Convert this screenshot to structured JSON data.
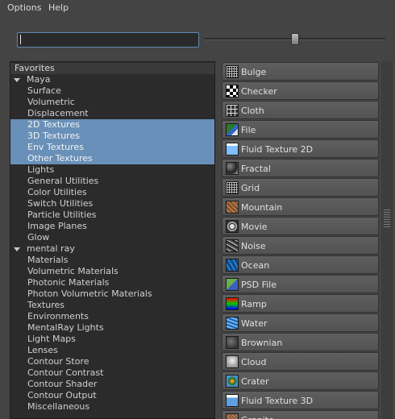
{
  "menu": {
    "items": [
      "Options",
      "Help"
    ]
  },
  "search": {
    "value": "",
    "placeholder": ""
  },
  "slider": {
    "value_fraction": 0.5
  },
  "tree": {
    "rows": [
      {
        "label": "Favorites",
        "kind": "top"
      },
      {
        "label": "Maya",
        "kind": "header"
      },
      {
        "label": "Surface",
        "kind": "item"
      },
      {
        "label": "Volumetric",
        "kind": "item"
      },
      {
        "label": "Displacement",
        "kind": "item"
      },
      {
        "label": "2D Textures",
        "kind": "item",
        "selected": true
      },
      {
        "label": "3D Textures",
        "kind": "item",
        "selected": true
      },
      {
        "label": "Env Textures",
        "kind": "item",
        "selected": true
      },
      {
        "label": "Other Textures",
        "kind": "item",
        "selected": true
      },
      {
        "label": "Lights",
        "kind": "item"
      },
      {
        "label": "General Utilities",
        "kind": "item"
      },
      {
        "label": "Color Utilities",
        "kind": "item"
      },
      {
        "label": "Switch Utilities",
        "kind": "item"
      },
      {
        "label": "Particle Utilities",
        "kind": "item"
      },
      {
        "label": "Image Planes",
        "kind": "item"
      },
      {
        "label": "Glow",
        "kind": "item"
      },
      {
        "label": "mental ray",
        "kind": "header"
      },
      {
        "label": "Materials",
        "kind": "item"
      },
      {
        "label": "Volumetric Materials",
        "kind": "item"
      },
      {
        "label": "Photonic Materials",
        "kind": "item"
      },
      {
        "label": "Photon Volumetric Materials",
        "kind": "item"
      },
      {
        "label": "Textures",
        "kind": "item"
      },
      {
        "label": "Environments",
        "kind": "item"
      },
      {
        "label": "MentalRay Lights",
        "kind": "item"
      },
      {
        "label": "Light Maps",
        "kind": "item"
      },
      {
        "label": "Lenses",
        "kind": "item"
      },
      {
        "label": "Contour Store",
        "kind": "item"
      },
      {
        "label": "Contour Contrast",
        "kind": "item"
      },
      {
        "label": "Contour Shader",
        "kind": "item"
      },
      {
        "label": "Contour Output",
        "kind": "item"
      },
      {
        "label": "Miscellaneous",
        "kind": "item"
      }
    ]
  },
  "nodes": [
    {
      "label": "Bulge",
      "icon": "bulge-icon",
      "swatch": "sw-grid"
    },
    {
      "label": "Checker",
      "icon": "checker-icon",
      "swatch": "sw-checker"
    },
    {
      "label": "Cloth",
      "icon": "cloth-icon",
      "swatch": "sw-cloth"
    },
    {
      "label": "File",
      "icon": "file-icon",
      "swatch": "sw-file"
    },
    {
      "label": "Fluid Texture 2D",
      "icon": "fluid-texture-2d-icon",
      "swatch": "sw-fluid2d"
    },
    {
      "label": "Fractal",
      "icon": "fractal-icon",
      "swatch": "sw-fractal"
    },
    {
      "label": "Grid",
      "icon": "grid-icon",
      "swatch": "sw-grid"
    },
    {
      "label": "Mountain",
      "icon": "mountain-icon",
      "swatch": "sw-mountain"
    },
    {
      "label": "Movie",
      "icon": "movie-icon",
      "swatch": "sw-movie"
    },
    {
      "label": "Noise",
      "icon": "noise-icon",
      "swatch": "sw-noise"
    },
    {
      "label": "Ocean",
      "icon": "ocean-icon",
      "swatch": "sw-ocean"
    },
    {
      "label": "PSD File",
      "icon": "psd-file-icon",
      "swatch": "sw-psd"
    },
    {
      "label": "Ramp",
      "icon": "ramp-icon",
      "swatch": "sw-ramp"
    },
    {
      "label": "Water",
      "icon": "water-icon",
      "swatch": "sw-water"
    },
    {
      "label": "Brownian",
      "icon": "brownian-icon",
      "swatch": "sw-brownian"
    },
    {
      "label": "Cloud",
      "icon": "cloud-icon",
      "swatch": "sw-cloud"
    },
    {
      "label": "Crater",
      "icon": "crater-icon",
      "swatch": "sw-crater"
    },
    {
      "label": "Fluid Texture 3D",
      "icon": "fluid-texture-3d-icon",
      "swatch": "sw-fluid3d"
    },
    {
      "label": "Granite",
      "icon": "granite-icon",
      "swatch": "sw-granite"
    }
  ],
  "colors": {
    "background": "#444444",
    "panel": "#2b2b2b",
    "selection": "#6990b8",
    "focus_border": "#5f87b3"
  }
}
